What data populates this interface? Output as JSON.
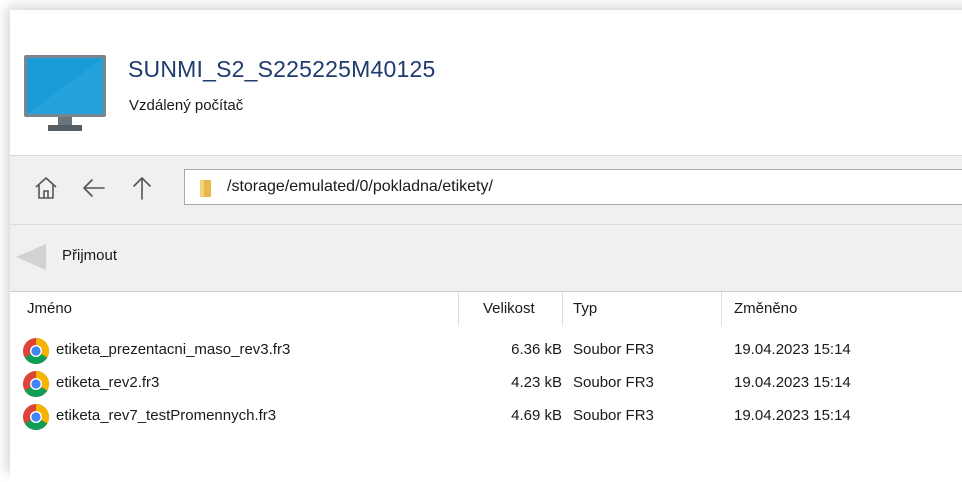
{
  "header": {
    "title": "SUNMI_S2_S225225M40125",
    "subtitle": "Vzdálený počítač",
    "icon": "monitor-icon"
  },
  "navigation": {
    "home_icon": "home-icon",
    "back_icon": "back-arrow-icon",
    "up_icon": "up-arrow-icon",
    "path": "/storage/emulated/0/pokladna/etikety/"
  },
  "toolbar": {
    "receive_label": "Přijmout",
    "receive_icon": "left-arrow-icon"
  },
  "filelist": {
    "columns": {
      "name": "Jméno",
      "size": "Velikost",
      "type": "Typ",
      "modified": "Změněno"
    },
    "rows": [
      {
        "name": "etiketa_prezentacni_maso_rev3.fr3",
        "size": "6.36 kB",
        "type": "Soubor FR3",
        "modified": "19.04.2023 15:14"
      },
      {
        "name": "etiketa_rev2.fr3",
        "size": "4.23 kB",
        "type": "Soubor FR3",
        "modified": "19.04.2023 15:14"
      },
      {
        "name": "etiketa_rev7_testPromennych.fr3",
        "size": "4.69 kB",
        "type": "Soubor FR3",
        "modified": "19.04.2023 15:14"
      }
    ]
  },
  "colors": {
    "title": "#1e3a6e",
    "bar_background": "#f0f0f0",
    "monitor_blue": "#1a9bd7"
  }
}
